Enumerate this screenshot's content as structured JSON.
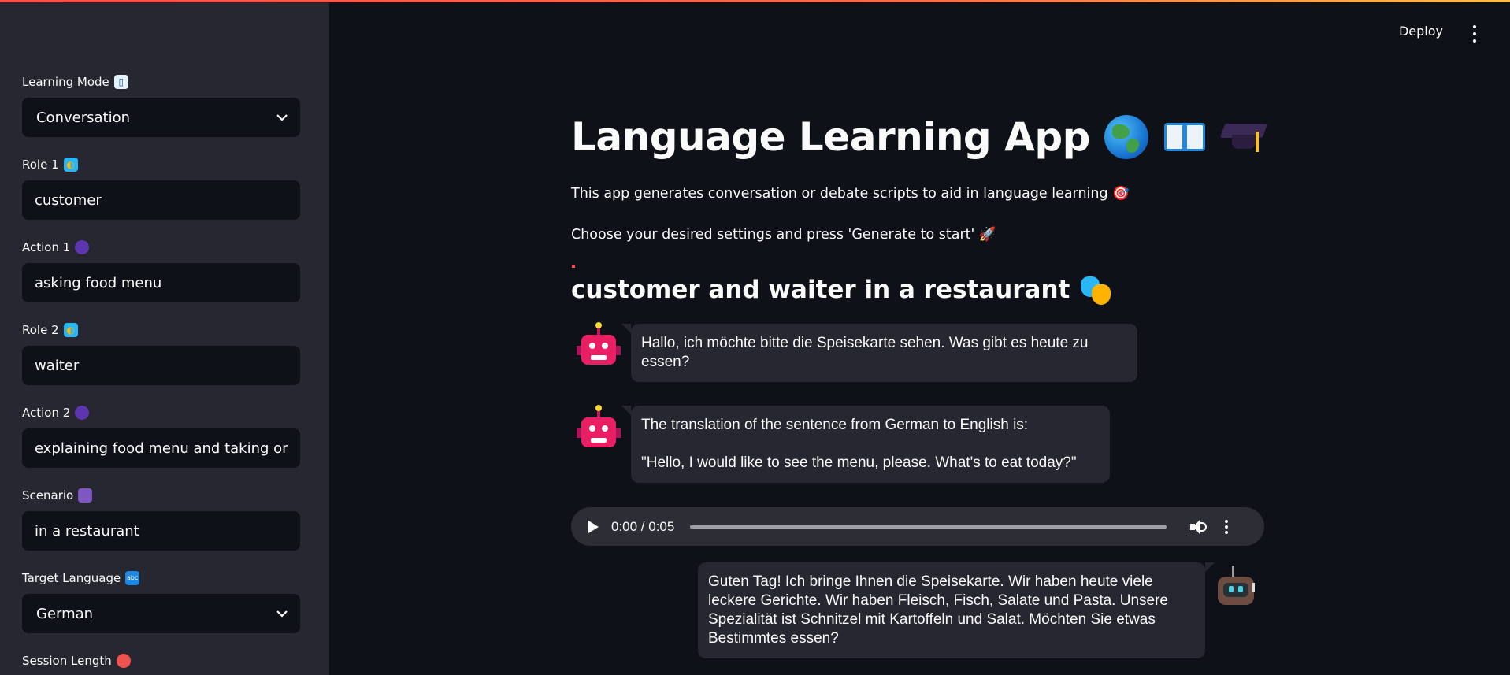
{
  "header": {
    "deploy_label": "Deploy"
  },
  "sidebar": {
    "fields": [
      {
        "label": "Learning Mode",
        "value": "Conversation",
        "type": "select",
        "icon": "book-icon"
      },
      {
        "label": "Role 1",
        "value": "customer",
        "type": "input",
        "icon": "masks-icon"
      },
      {
        "label": "Action 1",
        "value": "asking food menu",
        "type": "input",
        "icon": "speaking-head-icon"
      },
      {
        "label": "Role 2",
        "value": "waiter",
        "type": "input",
        "icon": "masks-icon"
      },
      {
        "label": "Action 2",
        "value": "explaining food menu and taking order",
        "type": "input",
        "icon": "speaking-head-icon"
      },
      {
        "label": "Scenario",
        "value": "in a restaurant",
        "type": "input",
        "icon": "camera-icon"
      },
      {
        "label": "Target Language",
        "value": "German",
        "type": "select",
        "icon": "abc-icon"
      },
      {
        "label": "Session Length",
        "icon": "alarm-clock-icon"
      }
    ]
  },
  "main": {
    "title": "Language Learning App",
    "intro_1": "This app generates conversation or debate scripts to aid in language learning 🎯",
    "intro_2": "Choose your desired settings and press 'Generate to start' 🚀",
    "scene_title": "customer and waiter in a restaurant",
    "messages": [
      {
        "side": "left",
        "avatar": "robot-pink-icon",
        "lines": [
          "Hallo, ich möchte bitte die Speisekarte sehen. Was gibt es heute zu essen?"
        ]
      },
      {
        "side": "left",
        "avatar": "robot-pink-icon",
        "lines": [
          "The translation of the sentence from German to English is:",
          "\"Hello, I would like to see the menu, please. What's to eat today?\""
        ]
      },
      {
        "side": "right",
        "avatar": "robot-brown-icon",
        "lines": [
          "Guten Tag! Ich bringe Ihnen die Speisekarte. Wir haben heute viele leckere Gerichte. Wir haben Fleisch, Fisch, Salate und Pasta. Unsere Spezialität ist Schnitzel mit Kartoffeln und Salat. Möchten Sie etwas Bestimmtes essen?"
        ]
      }
    ],
    "audio": {
      "time": "0:00 / 0:05"
    }
  },
  "colors": {
    "accent": "#ff4b4b",
    "sidebar_bg": "#262730",
    "main_bg": "#0e1117"
  }
}
